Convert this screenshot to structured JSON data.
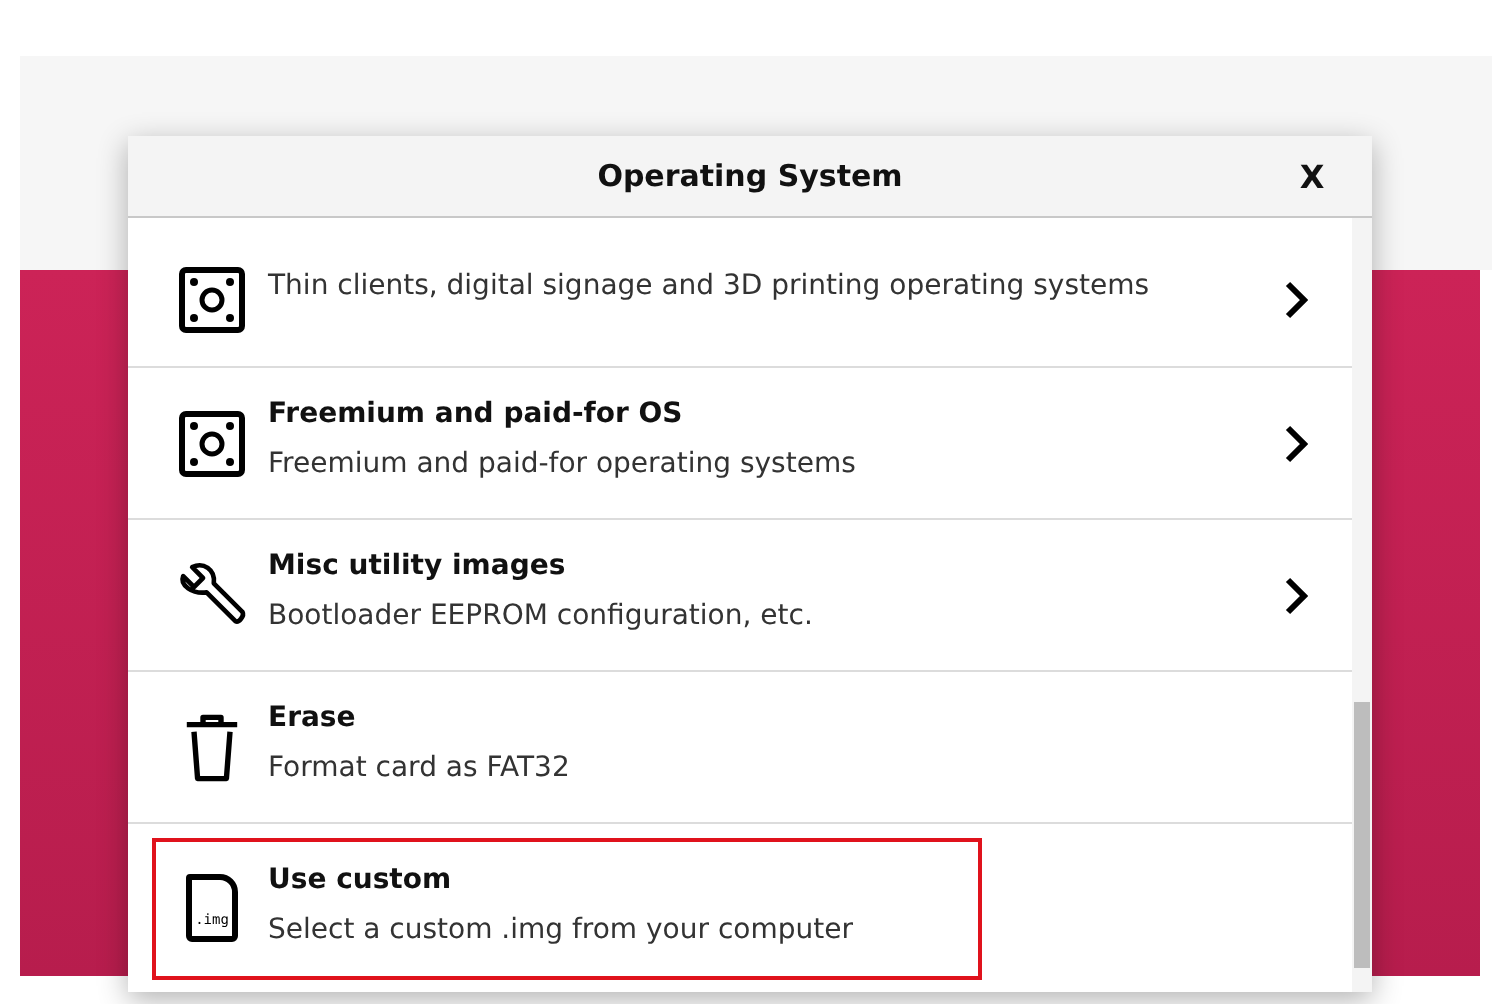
{
  "dialog": {
    "title": "Operating System",
    "close_label": "X"
  },
  "items": [
    {
      "kind": "board",
      "description": "Thin clients, digital signage and 3D printing operating systems",
      "has_submenu": true,
      "highlighted": false
    },
    {
      "kind": "board",
      "title": "Freemium and paid-for OS",
      "description": "Freemium and paid-for operating systems",
      "has_submenu": true,
      "highlighted": false
    },
    {
      "kind": "wrench",
      "title": "Misc utility images",
      "description": "Bootloader EEPROM configuration, etc.",
      "has_submenu": true,
      "highlighted": false
    },
    {
      "kind": "trash",
      "title": "Erase",
      "description": "Format card as FAT32",
      "has_submenu": false,
      "highlighted": false
    },
    {
      "kind": "file",
      "title": "Use custom",
      "description": "Select a custom .img from your computer",
      "has_submenu": false,
      "highlighted": true,
      "icon_text": ".img"
    }
  ]
}
